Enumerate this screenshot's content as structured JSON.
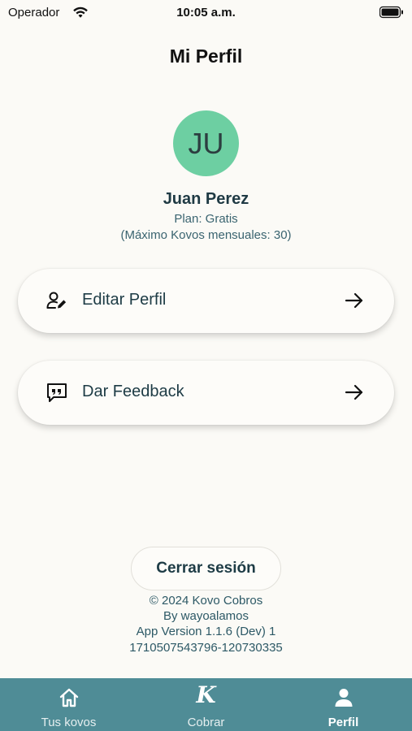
{
  "status_bar": {
    "carrier": "Operador",
    "time": "10:05 a.m."
  },
  "header": {
    "title": "Mi Perfil"
  },
  "profile": {
    "initials": "JU",
    "name": "Juan Perez",
    "plan": "Plan: Gratis",
    "plan_limit": "(Máximo Kovos mensuales: 30)",
    "avatar_color": "#6dcfa2"
  },
  "menu": {
    "items": [
      {
        "label": "Editar Perfil",
        "icon": "edit-user-icon"
      },
      {
        "label": "Dar Feedback",
        "icon": "feedback-icon"
      }
    ]
  },
  "logout": {
    "label": "Cerrar sesión"
  },
  "footer": {
    "copyright": "© 2024 Kovo Cobros",
    "author": "By wayoalamos",
    "version": "App Version 1.1.6 (Dev) 1",
    "build": "1710507543796-120730335"
  },
  "bottom_nav": {
    "background": "#4f8c96",
    "items": [
      {
        "label": "Tus kovos",
        "icon": "home-icon",
        "active": false
      },
      {
        "label": "Cobrar",
        "icon": "kovo-k-icon",
        "active": false
      },
      {
        "label": "Perfil",
        "icon": "person-icon",
        "active": true
      }
    ]
  }
}
